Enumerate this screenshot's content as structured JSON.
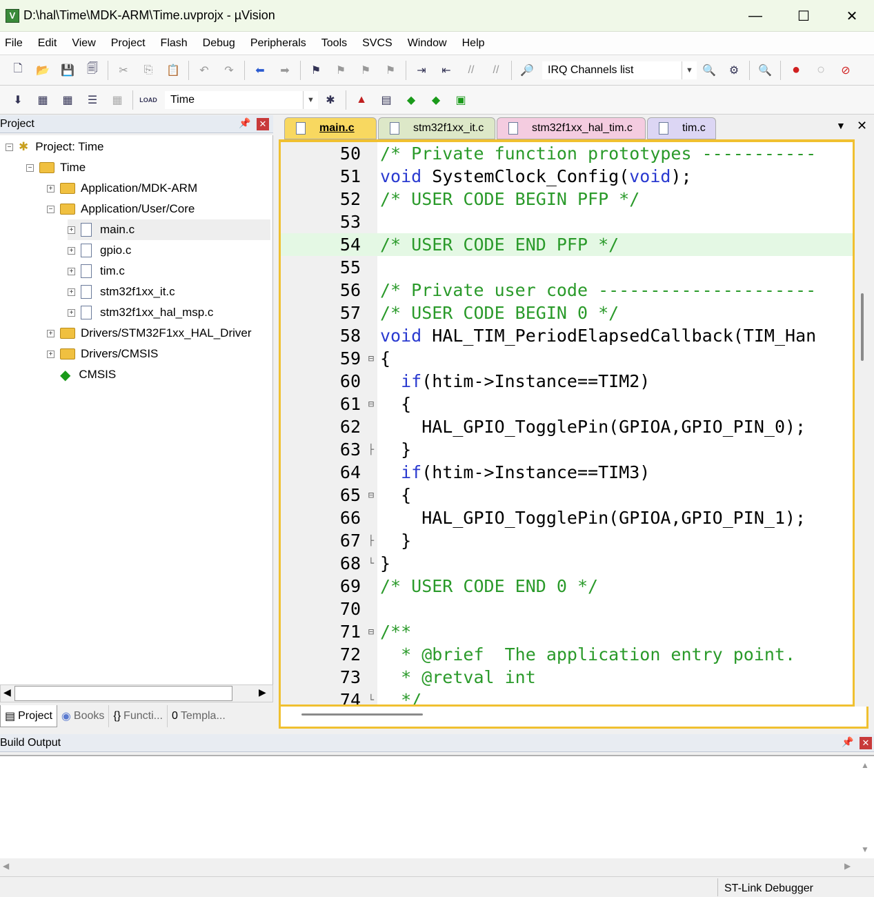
{
  "window": {
    "title": "D:\\hal\\Time\\MDK-ARM\\Time.uvprojx - µVision",
    "minimize": "—",
    "maximize": "☐",
    "close": "✕"
  },
  "menu": [
    "File",
    "Edit",
    "View",
    "Project",
    "Flash",
    "Debug",
    "Peripherals",
    "Tools",
    "SVCS",
    "Window",
    "Help"
  ],
  "toolbar": {
    "irq_combo": "IRQ Channels list",
    "target_combo": "Time"
  },
  "project_panel": {
    "title": "Project",
    "tree": [
      {
        "label": "Project: Time",
        "level": 0
      },
      {
        "label": "Time",
        "level": 1
      },
      {
        "label": "Application/MDK-ARM",
        "level": 2
      },
      {
        "label": "Application/User/Core",
        "level": 2
      },
      {
        "label": "main.c",
        "level": 3
      },
      {
        "label": "gpio.c",
        "level": 3
      },
      {
        "label": "tim.c",
        "level": 3
      },
      {
        "label": "stm32f1xx_it.c",
        "level": 3
      },
      {
        "label": "stm32f1xx_hal_msp.c",
        "level": 3
      },
      {
        "label": "Drivers/STM32F1xx_HAL_Driver",
        "level": 2
      },
      {
        "label": "Drivers/CMSIS",
        "level": 2
      },
      {
        "label": "CMSIS",
        "level": 2
      }
    ],
    "tabs": [
      "Project",
      "Books",
      "Functi...",
      "Templa..."
    ]
  },
  "editor_tabs": [
    "main.c",
    "stm32f1xx_it.c",
    "stm32f1xx_hal_tim.c",
    "tim.c"
  ],
  "code_lines": [
    {
      "n": "50",
      "t": "/* Private function prototypes -----------"
    },
    {
      "n": "51",
      "t": "void SystemClock_Config(void);"
    },
    {
      "n": "52",
      "t": "/* USER CODE BEGIN PFP */"
    },
    {
      "n": "53",
      "t": ""
    },
    {
      "n": "54",
      "t": "/* USER CODE END PFP */"
    },
    {
      "n": "55",
      "t": ""
    },
    {
      "n": "56",
      "t": "/* Private user code ---------------------"
    },
    {
      "n": "57",
      "t": "/* USER CODE BEGIN 0 */"
    },
    {
      "n": "58",
      "t": "void HAL_TIM_PeriodElapsedCallback(TIM_Han"
    },
    {
      "n": "59",
      "t": "{"
    },
    {
      "n": "60",
      "t": "  if(htim->Instance==TIM2)"
    },
    {
      "n": "61",
      "t": "  {"
    },
    {
      "n": "62",
      "t": "    HAL_GPIO_TogglePin(GPIOA,GPIO_PIN_0);"
    },
    {
      "n": "63",
      "t": "  }"
    },
    {
      "n": "64",
      "t": "  if(htim->Instance==TIM3)"
    },
    {
      "n": "65",
      "t": "  {"
    },
    {
      "n": "66",
      "t": "    HAL_GPIO_TogglePin(GPIOA,GPIO_PIN_1);"
    },
    {
      "n": "67",
      "t": "  }"
    },
    {
      "n": "68",
      "t": "}"
    },
    {
      "n": "69",
      "t": "/* USER CODE END 0 */"
    },
    {
      "n": "70",
      "t": ""
    },
    {
      "n": "71",
      "t": "/**"
    },
    {
      "n": "72",
      "t": "  * @brief  The application entry point."
    },
    {
      "n": "73",
      "t": "  * @retval int"
    },
    {
      "n": "74",
      "t": "  */"
    }
  ],
  "build_output": {
    "title": "Build Output"
  },
  "status": {
    "debugger": "ST-Link Debugger"
  }
}
